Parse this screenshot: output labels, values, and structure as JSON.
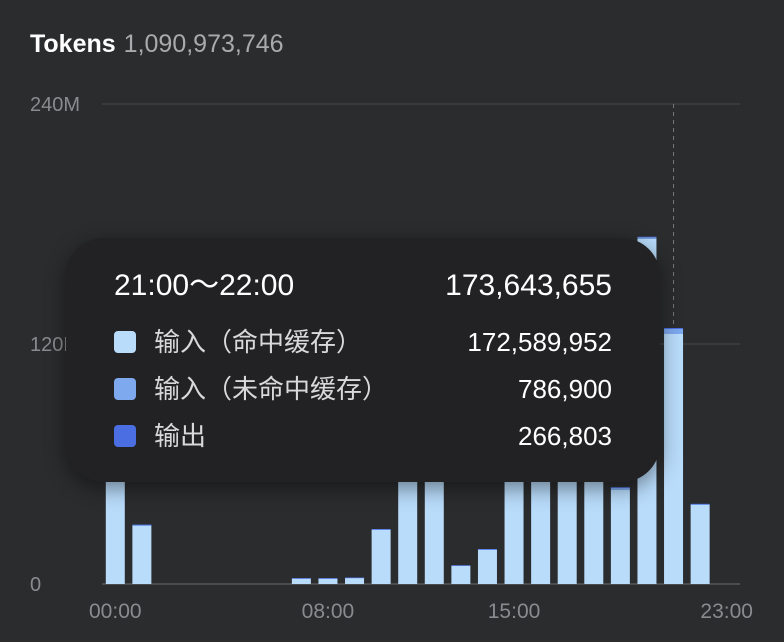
{
  "header": {
    "label": "Tokens",
    "total": "1,090,973,746"
  },
  "chart_data": {
    "type": "bar",
    "stacked": true,
    "categories": [
      "00:00",
      "01:00",
      "02:00",
      "03:00",
      "04:00",
      "05:00",
      "06:00",
      "07:00",
      "08:00",
      "09:00",
      "10:00",
      "11:00",
      "12:00",
      "13:00",
      "14:00",
      "15:00",
      "16:00",
      "17:00",
      "18:00",
      "19:00",
      "20:00",
      "21:00",
      "22:00",
      "23:00"
    ],
    "x_tick_labels": [
      "00:00",
      "08:00",
      "15:00",
      "23:00"
    ],
    "y_tick_labels": [
      "240M",
      "120M",
      "0"
    ],
    "ylim": [
      0,
      240000000
    ],
    "grid": true,
    "hover_category": "21:00",
    "series": [
      {
        "name": "输入（命中缓存）",
        "color": "#b9dcfb",
        "values": [
          57000000,
          29000000,
          0,
          0,
          0,
          0,
          0,
          2700000,
          2700000,
          3000000,
          27000000,
          64000000,
          64000000,
          9000000,
          17000000,
          56000000,
          57000000,
          56000000,
          53000000,
          47000000,
          172589952,
          125000000,
          39500000,
          0
        ]
      },
      {
        "name": "输入（未命中缓存）",
        "color": "#7ea9ef",
        "values": [
          1500000,
          600000,
          0,
          0,
          0,
          0,
          0,
          200000,
          200000,
          200000,
          400000,
          800000,
          800000,
          300000,
          400000,
          1200000,
          1100000,
          1200000,
          1800000,
          1200000,
          786900,
          2500000,
          500000,
          0
        ]
      },
      {
        "name": "输出",
        "color": "#4b6fe3",
        "values": [
          200000,
          100000,
          0,
          0,
          0,
          0,
          0,
          50000,
          50000,
          50000,
          100000,
          200000,
          200000,
          80000,
          100000,
          200000,
          200000,
          200000,
          300000,
          200000,
          266803,
          500000,
          100000,
          0
        ]
      }
    ]
  },
  "tooltip": {
    "range": "21:00～22:00",
    "total": "173,643,655",
    "items": [
      {
        "label": "输入（命中缓存）",
        "value": "172,589,952",
        "color": "#b9dcfb"
      },
      {
        "label": "输入（未命中缓存）",
        "value": "786,900",
        "color": "#7ea9ef"
      },
      {
        "label": "输出",
        "value": "266,803",
        "color": "#4b6fe3"
      }
    ]
  }
}
